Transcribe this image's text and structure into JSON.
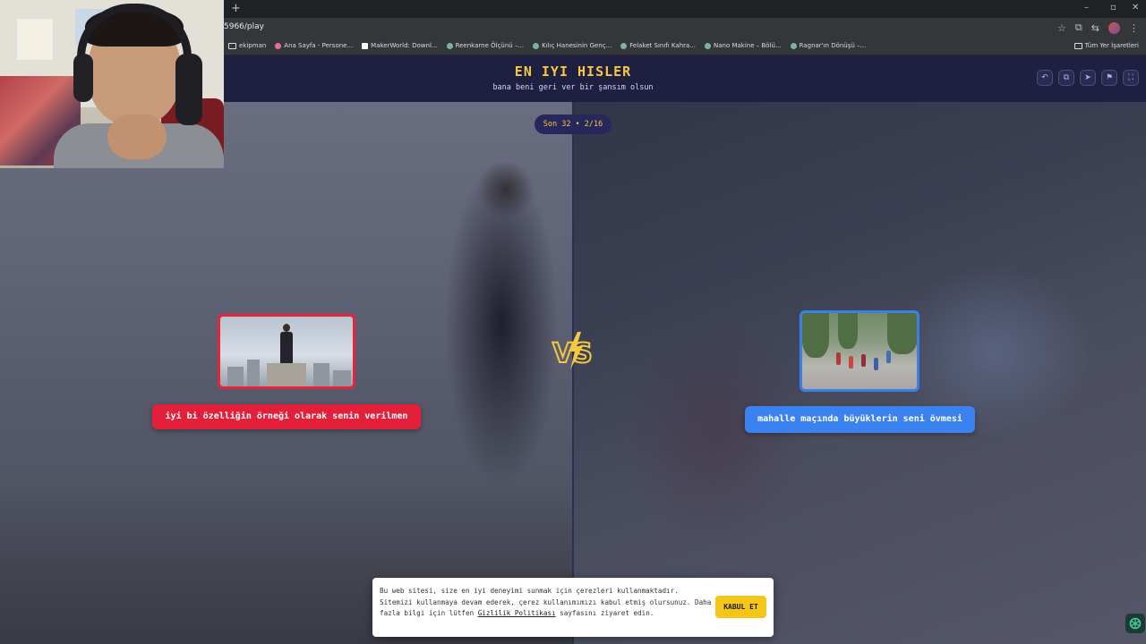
{
  "browser": {
    "new_tab_glyph": "+",
    "url": "5966/play",
    "window_controls": [
      "–",
      "▫",
      "✕"
    ],
    "bookmarks": [
      {
        "label": "ekipman",
        "icon": "folder-icon"
      },
      {
        "label": "Ana Sayfa - Persone...",
        "icon": "site-icon"
      },
      {
        "label": "MakerWorld: Downl...",
        "icon": "site-icon"
      },
      {
        "label": "Reenkarne Ölçünü –...",
        "icon": "site-icon"
      },
      {
        "label": "Kılıç Hanesinin Genç...",
        "icon": "site-icon"
      },
      {
        "label": "Felaket Sınıfı Kahra...",
        "icon": "site-icon"
      },
      {
        "label": "Nano Makine – Bölü...",
        "icon": "site-icon"
      },
      {
        "label": "Ragnar'ın Dönüşü –...",
        "icon": "site-icon"
      }
    ],
    "all_bookmarks_label": "Tüm Yer İşaretleri"
  },
  "header": {
    "title": "EN IYI HISLER",
    "subtitle": "bana beni geri ver bir şansım olsun",
    "buttons": [
      "undo-icon",
      "share-icon",
      "send-icon",
      "flag-icon",
      "fullscreen-icon"
    ]
  },
  "round": {
    "label": "Son 32 • 2/16"
  },
  "left_option": {
    "label": "iyi bi özelliğin örneği olarak senin verilmen",
    "accent": "#e31f3a"
  },
  "right_option": {
    "label": "mahalle maçında büyüklerin seni övmesi",
    "accent": "#3a82f0"
  },
  "vs": {
    "text": "VS",
    "color": "#f5c842"
  },
  "cookie_banner": {
    "text_before": "Bu web sitesi, size en iyi deneyimi sunmak için çerezleri kullanmaktadır. Sitemizi kullanmaya devam ederek, çerez kullanımımızı kabul etmiş olursunuz. Daha fazla bilgi için lütfen ",
    "link_text": "Gizlilik Politikası",
    "text_after": " sayfasını ziyaret edin.",
    "accept_label": "KABUL ET"
  }
}
